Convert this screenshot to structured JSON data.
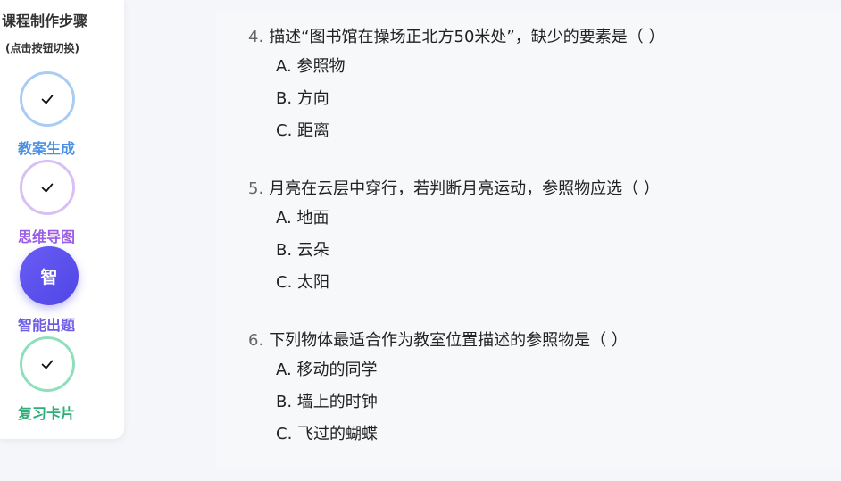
{
  "sidebar": {
    "title": "课程制作步骤",
    "subtitle": "(点击按钮切换)",
    "steps": [
      {
        "label": "教案生成",
        "status": "done",
        "color": "#4a90e2",
        "ring": "#a9cdf2"
      },
      {
        "label": "思维导图",
        "status": "done",
        "color": "#9b5de5",
        "ring": "#d8bff4"
      },
      {
        "label": "智能出题",
        "status": "active",
        "icon_text": "智",
        "color": "#6c5ce7"
      },
      {
        "label": "复习卡片",
        "status": "done",
        "color": "#2fae7a",
        "ring": "#8ee0bd"
      }
    ]
  },
  "questions": [
    {
      "number": "4.",
      "stem": "描述“图书馆在操场正北方50米处”，缺少的要素是（ ）",
      "options": [
        "A. 参照物",
        "B. 方向",
        "C. 距离"
      ]
    },
    {
      "number": "5.",
      "stem": "月亮在云层中穿行，若判断月亮运动，参照物应选（ ）",
      "options": [
        "A. 地面",
        "B. 云朵",
        "C. 太阳"
      ]
    },
    {
      "number": "6.",
      "stem": "下列物体最适合作为教室位置描述的参照物是（ ）",
      "options": [
        "A. 移动的同学",
        "B. 墙上的时钟",
        "C. 飞过的蝴蝶"
      ]
    }
  ]
}
